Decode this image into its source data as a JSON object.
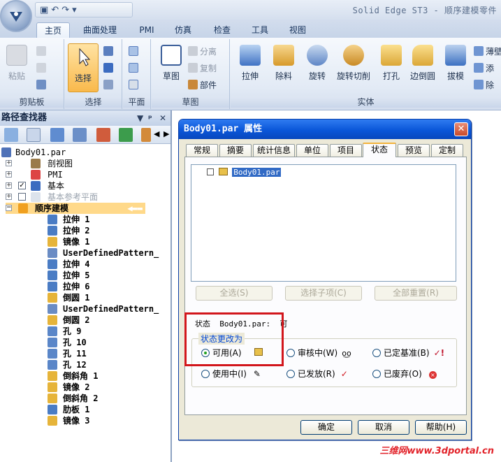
{
  "window": {
    "title": "Solid Edge ST3 - 顺序建模零件"
  },
  "ribbon": {
    "tabs": [
      "主页",
      "曲面处理",
      "PMI",
      "仿真",
      "检查",
      "工具",
      "视图"
    ],
    "groups": {
      "clipboard": {
        "label": "剪贴板",
        "paste": "粘贴"
      },
      "select": {
        "label": "选择",
        "select": "选择"
      },
      "plane": {
        "label": "平面"
      },
      "sketch": {
        "label": "草图",
        "sketch": "草图",
        "split": "分离",
        "copy": "复制",
        "part": "部件"
      },
      "solid": {
        "label": "实体",
        "extrude": "拉伸",
        "cut": "除料",
        "revolve": "旋转",
        "revolve_cut": "旋转切削",
        "hole": "打孔",
        "round": "边倒圆",
        "draft": "拔模",
        "thin": "薄壁",
        "add": "添",
        "remove": "除"
      }
    }
  },
  "pathfinder": {
    "title": "路径查找器",
    "items": [
      {
        "label": "Body01.par",
        "bold": false
      },
      {
        "label": "剖视图",
        "bold": false
      },
      {
        "label": "PMI",
        "bold": false
      },
      {
        "label": "基本",
        "bold": false
      },
      {
        "label": "基本参考平面",
        "bold": false
      },
      {
        "label": "顺序建模",
        "bold": true
      },
      {
        "label": "拉伸 1",
        "bold": true
      },
      {
        "label": "拉伸 2",
        "bold": true
      },
      {
        "label": "镜像 1",
        "bold": true
      },
      {
        "label": "UserDefinedPattern_",
        "bold": true
      },
      {
        "label": "拉伸 4",
        "bold": true
      },
      {
        "label": "拉伸 5",
        "bold": true
      },
      {
        "label": "拉伸 6",
        "bold": true
      },
      {
        "label": "倒圆 1",
        "bold": true
      },
      {
        "label": "UserDefinedPattern_",
        "bold": true
      },
      {
        "label": "倒圆 2",
        "bold": true
      },
      {
        "label": "孔 9",
        "bold": true
      },
      {
        "label": "孔 10",
        "bold": true
      },
      {
        "label": "孔 11",
        "bold": true
      },
      {
        "label": "孔 12",
        "bold": true
      },
      {
        "label": "倒斜角 1",
        "bold": true
      },
      {
        "label": "镜像 2",
        "bold": true
      },
      {
        "label": "倒斜角 2",
        "bold": true
      },
      {
        "label": "肋板 1",
        "bold": true
      },
      {
        "label": "镜像 3",
        "bold": true
      }
    ]
  },
  "dialog": {
    "title": "Body01.par 属性",
    "close": "✕",
    "tabs": [
      "常规",
      "摘要",
      "统计信息",
      "单位",
      "项目",
      "状态",
      "预览",
      "定制"
    ],
    "active_tab": "状态",
    "list_item": "Body01.par",
    "buttons_panel": [
      "全选(S)",
      "选择子项(C)",
      "全部重置(R)"
    ],
    "status_line": "状态  Body01.par:  可",
    "group_label": "状态更改为",
    "radios": [
      "可用(A)",
      "审核中(W)",
      "已定基准(B)",
      "使用中(I)",
      "已发放(R)",
      "已废弃(O)"
    ],
    "selected_radio": "可用(A)",
    "ok": "确定",
    "cancel": "取消",
    "help": "帮助(H)"
  },
  "watermark": "三维网www.3dportal.cn"
}
